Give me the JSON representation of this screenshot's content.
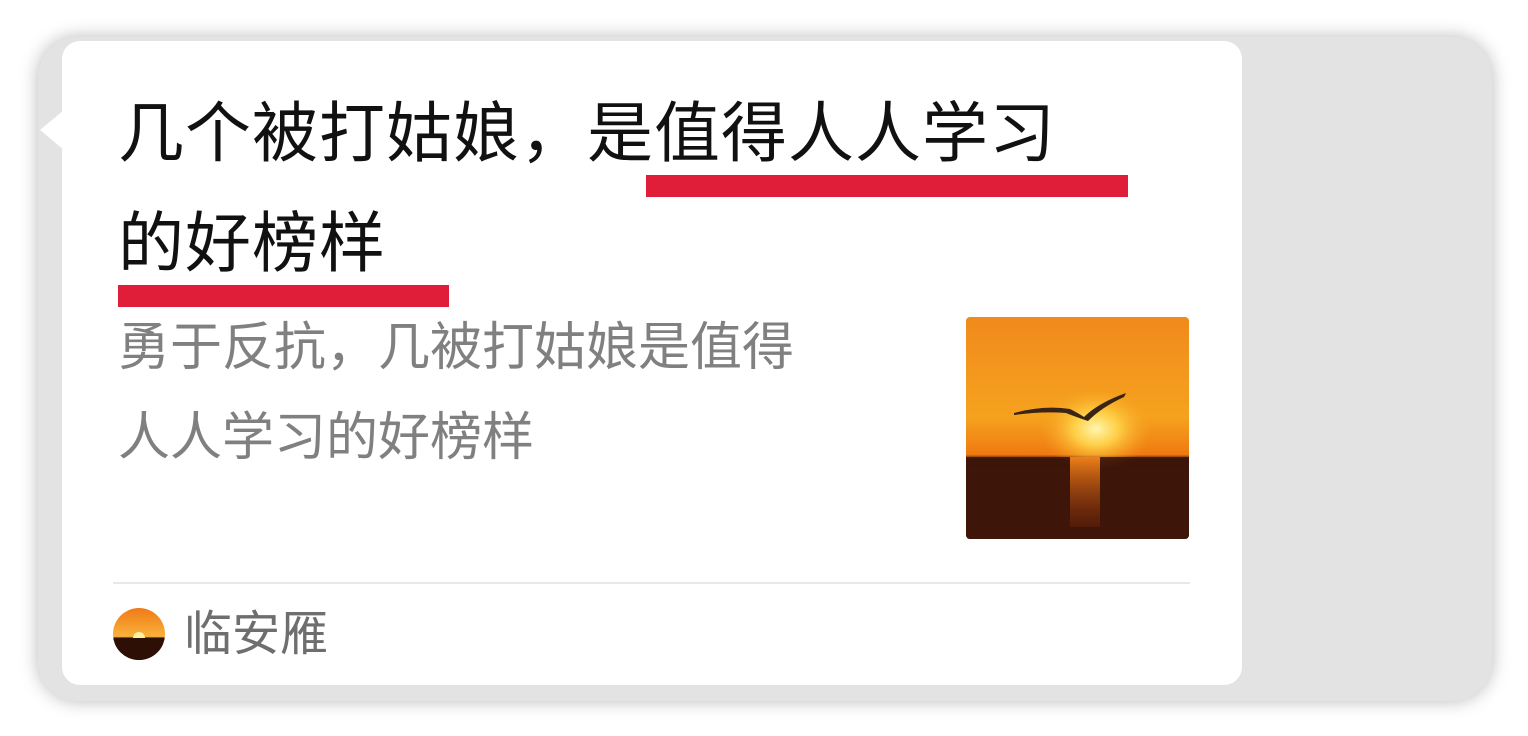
{
  "card": {
    "title_line_1": "几个被打姑娘，是值得人人学习",
    "title_line_2": "的好榜样",
    "description_line_1": "勇于反抗，几被打姑娘是值得",
    "description_line_2": "人人学习的好榜样",
    "thumbnail_icon": "sunset-seagull-image",
    "source": {
      "avatar_icon": "sunset-avatar-icon",
      "name": "临安雁"
    }
  },
  "colors": {
    "underline": "#e01e3a",
    "title_text": "#111111",
    "description_text": "#808080",
    "source_text": "#6e6e6e",
    "background": "#e3e3e3",
    "bubble": "#ffffff"
  }
}
